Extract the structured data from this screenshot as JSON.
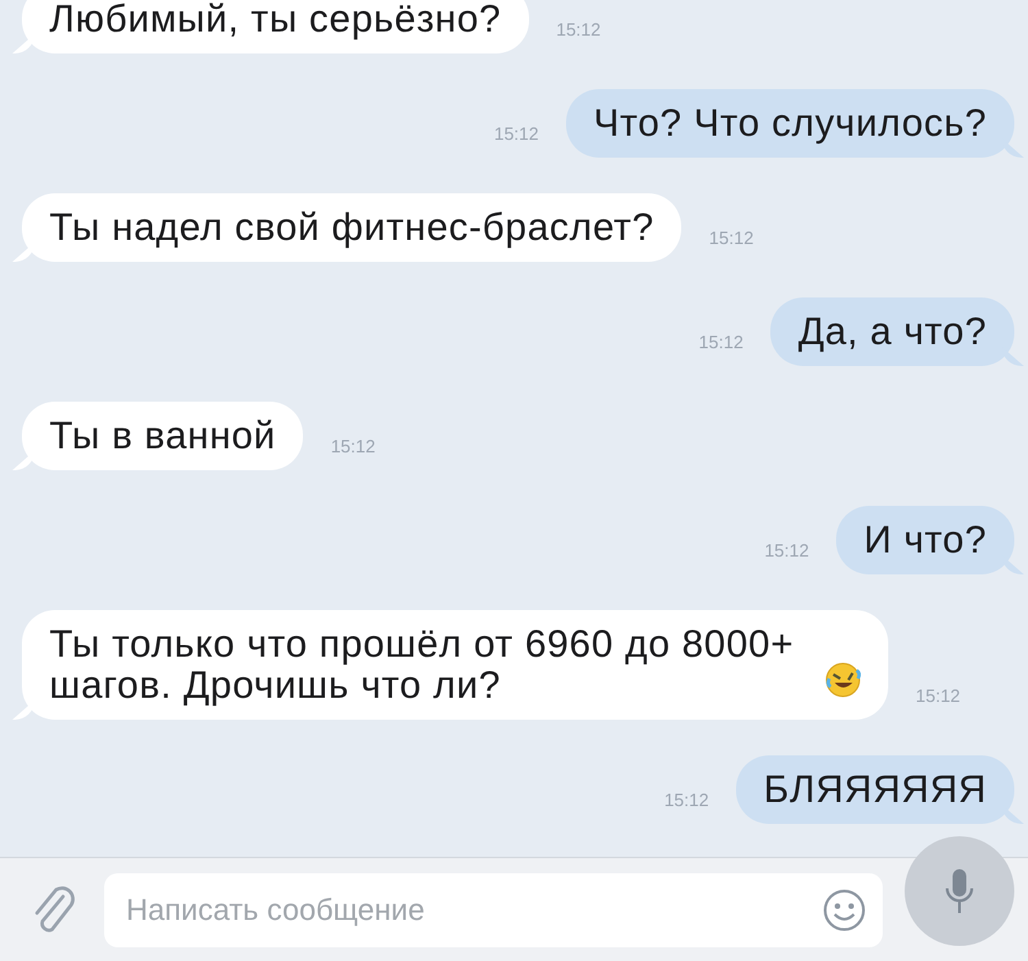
{
  "messages": [
    {
      "kind": "incoming",
      "text": "Любимый, ты серьёзно?",
      "time": "15:12",
      "has_emoji": false
    },
    {
      "kind": "outgoing",
      "text": "Что? Что случилось?",
      "time": "15:12",
      "has_emoji": false
    },
    {
      "kind": "incoming",
      "text": "Ты надел свой фитнес-браслет?",
      "time": "15:12",
      "has_emoji": false
    },
    {
      "kind": "outgoing",
      "text": "Да, а что?",
      "time": "15:12",
      "has_emoji": false
    },
    {
      "kind": "incoming",
      "text": "Ты в ванной",
      "time": "15:12",
      "has_emoji": false
    },
    {
      "kind": "outgoing",
      "text": "И что?",
      "time": "15:12",
      "has_emoji": false
    },
    {
      "kind": "incoming",
      "text": "Ты только что прошёл от 6960 до 8000+ шагов. Дрочишь что ли?",
      "time": "15:12",
      "has_emoji": true
    },
    {
      "kind": "outgoing",
      "text": "БЛЯЯЯЯЯЯ",
      "time": "15:12",
      "has_emoji": false
    }
  ],
  "composer": {
    "placeholder": "Написать сообщение"
  }
}
